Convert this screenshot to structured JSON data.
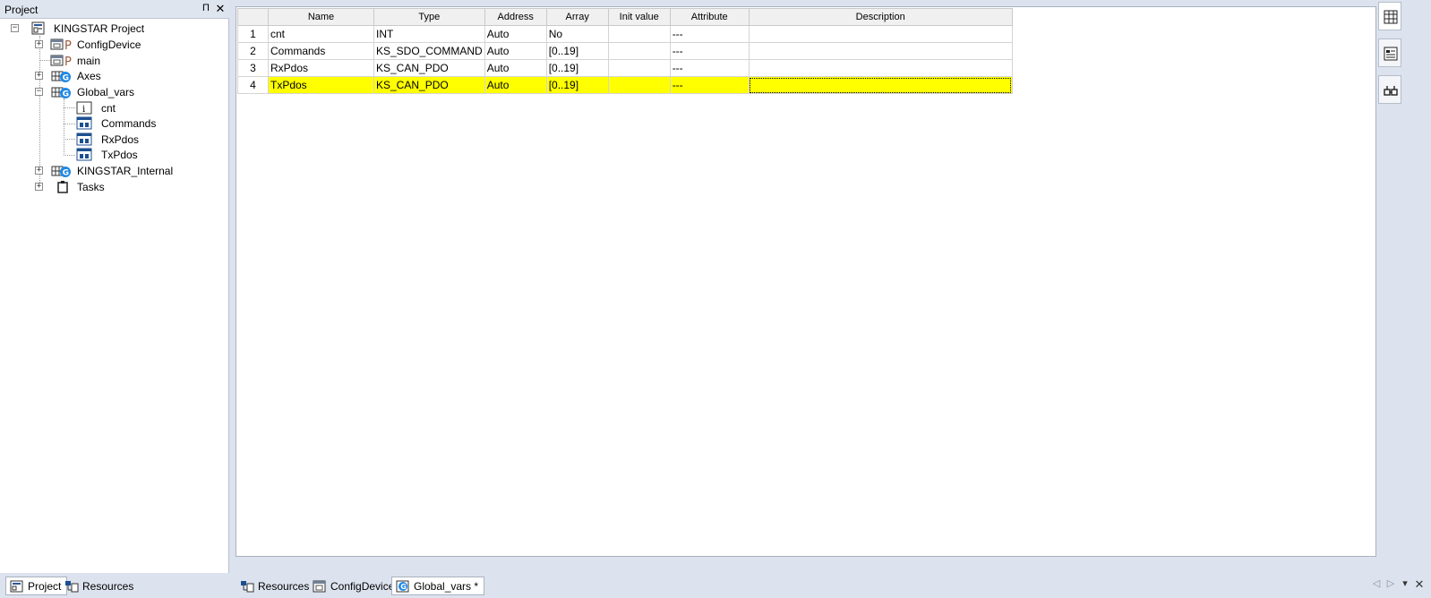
{
  "project_pane": {
    "title": "Project",
    "pin_glyph": "Π",
    "close_glyph": "✕",
    "tree": [
      {
        "label": "KINGSTAR Project",
        "icon": "project-icon",
        "expander": "−"
      },
      {
        "label": "ConfigDevice",
        "icon": "config-device-icon",
        "expander": "+"
      },
      {
        "label": "main",
        "icon": "program-icon"
      },
      {
        "label": "Axes",
        "icon": "global-vars-icon",
        "expander": "+"
      },
      {
        "label": "Global_vars",
        "icon": "global-vars-icon",
        "expander": "−"
      },
      {
        "label": "cnt",
        "icon": "variable-icon"
      },
      {
        "label": "Commands",
        "icon": "struct-icon"
      },
      {
        "label": "RxPdos",
        "icon": "struct-icon"
      },
      {
        "label": "TxPdos",
        "icon": "struct-icon"
      },
      {
        "label": "KINGSTAR_Internal",
        "icon": "global-vars-icon",
        "expander": "+"
      },
      {
        "label": "Tasks",
        "icon": "tasks-icon",
        "expander": "+"
      }
    ]
  },
  "grid": {
    "columns": [
      "Name",
      "Type",
      "Address",
      "Array",
      "Init value",
      "Attribute",
      "Description"
    ],
    "rows": [
      {
        "num": "1",
        "name": "cnt",
        "type": "INT",
        "address": "Auto",
        "array": "No",
        "init": "",
        "attribute": "---",
        "description": ""
      },
      {
        "num": "2",
        "name": "Commands",
        "type": "KS_SDO_COMMAND",
        "address": "Auto",
        "array": "[0..19]",
        "init": "",
        "attribute": "---",
        "description": ""
      },
      {
        "num": "3",
        "name": "RxPdos",
        "type": "KS_CAN_PDO",
        "address": "Auto",
        "array": "[0..19]",
        "init": "",
        "attribute": "---",
        "description": ""
      },
      {
        "num": "4",
        "name": "TxPdos",
        "type": "KS_CAN_PDO",
        "address": "Auto",
        "array": "[0..19]",
        "init": "",
        "attribute": "---",
        "description": ""
      }
    ],
    "selected_row": 4,
    "selected_color": "#ffff00"
  },
  "right_toolbar": [
    "grid-view-icon",
    "text-view-icon",
    "dictionary-icon"
  ],
  "left_tabs": [
    {
      "label": "Project",
      "icon": "project-icon",
      "active": true
    },
    {
      "label": "Resources",
      "icon": "resources-icon",
      "active": false
    }
  ],
  "doc_tabs": [
    {
      "label": "Resources",
      "icon": "resources-icon",
      "active": false
    },
    {
      "label": "ConfigDevice",
      "icon": "config-device-icon",
      "active": false
    },
    {
      "label": "Global_vars *",
      "icon": "global-vars-tab-icon",
      "active": true
    }
  ],
  "tab_nav": {
    "prev": "◁",
    "next": "▷",
    "menu": "▾",
    "close": "✕"
  }
}
